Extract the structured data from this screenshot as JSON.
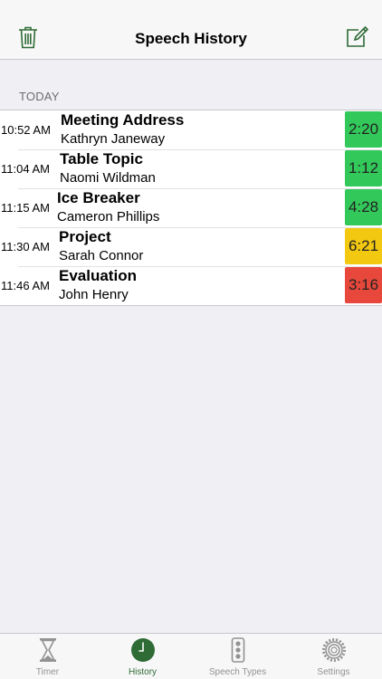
{
  "header": {
    "title": "Speech History",
    "left_icon": "trash-icon",
    "right_icon": "compose-icon"
  },
  "colors": {
    "accent": "#2e6b35",
    "green": "#32c85a",
    "yellow": "#f2c811",
    "red": "#e8483b"
  },
  "section": {
    "title": "TODAY"
  },
  "speeches": [
    {
      "time": "10:52 AM",
      "type": "Meeting Address",
      "speaker": "Kathryn Janeway",
      "duration": "2:20",
      "status": "green"
    },
    {
      "time": "11:04 AM",
      "type": "Table Topic",
      "speaker": "Naomi Wildman",
      "duration": "1:12",
      "status": "green"
    },
    {
      "time": "11:15 AM",
      "type": "Ice Breaker",
      "speaker": "Cameron Phillips",
      "duration": "4:28",
      "status": "green"
    },
    {
      "time": "11:30 AM",
      "type": "Project",
      "speaker": "Sarah Connor",
      "duration": "6:21",
      "status": "yellow"
    },
    {
      "time": "11:46 AM",
      "type": "Evaluation",
      "speaker": "John Henry",
      "duration": "3:16",
      "status": "red"
    }
  ],
  "tabs": [
    {
      "label": "Timer",
      "icon": "hourglass-icon",
      "active": false
    },
    {
      "label": "History",
      "icon": "clock-icon",
      "active": true
    },
    {
      "label": "Speech Types",
      "icon": "traffic-light-icon",
      "active": false
    },
    {
      "label": "Settings",
      "icon": "gear-icon",
      "active": false
    }
  ]
}
